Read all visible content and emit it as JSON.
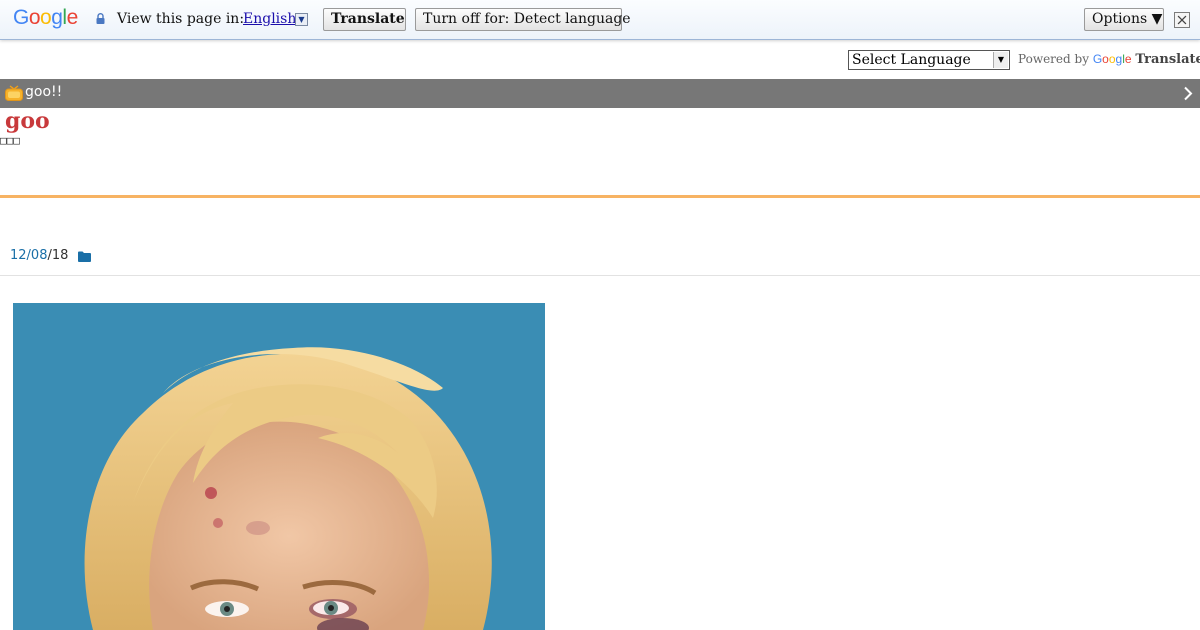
{
  "translate_bar": {
    "logo": {
      "letters": [
        "G",
        "o",
        "o",
        "g",
        "l",
        "e"
      ]
    },
    "view_text": "View this page in:",
    "language": "English",
    "translate_button": "Translate",
    "turn_off_button": "Turn off for: Detect language",
    "options_button": "Options ▼",
    "icons": [
      "lock-icon",
      "dropdown-arrow-icon",
      "close-icon"
    ]
  },
  "language_widget": {
    "select_value": "Select Language",
    "powered_by": "Powered by",
    "google": "Google",
    "translate": "Translate"
  },
  "navbar": {
    "title": "goo!!",
    "icons": [
      "tv-icon",
      "chevron-right-icon"
    ]
  },
  "site": {
    "logo": "goo",
    "subtitle": "□□□"
  },
  "post": {
    "date_link": "12/08",
    "date_rest": "/18",
    "icons": [
      "folder-icon"
    ]
  },
  "colors": {
    "accent_orange": "#f7b363",
    "navbar_grey": "#777777",
    "logo_red": "#c8393b",
    "link_blue": "#1a6fa7",
    "photo_background": "#3a8db4"
  }
}
